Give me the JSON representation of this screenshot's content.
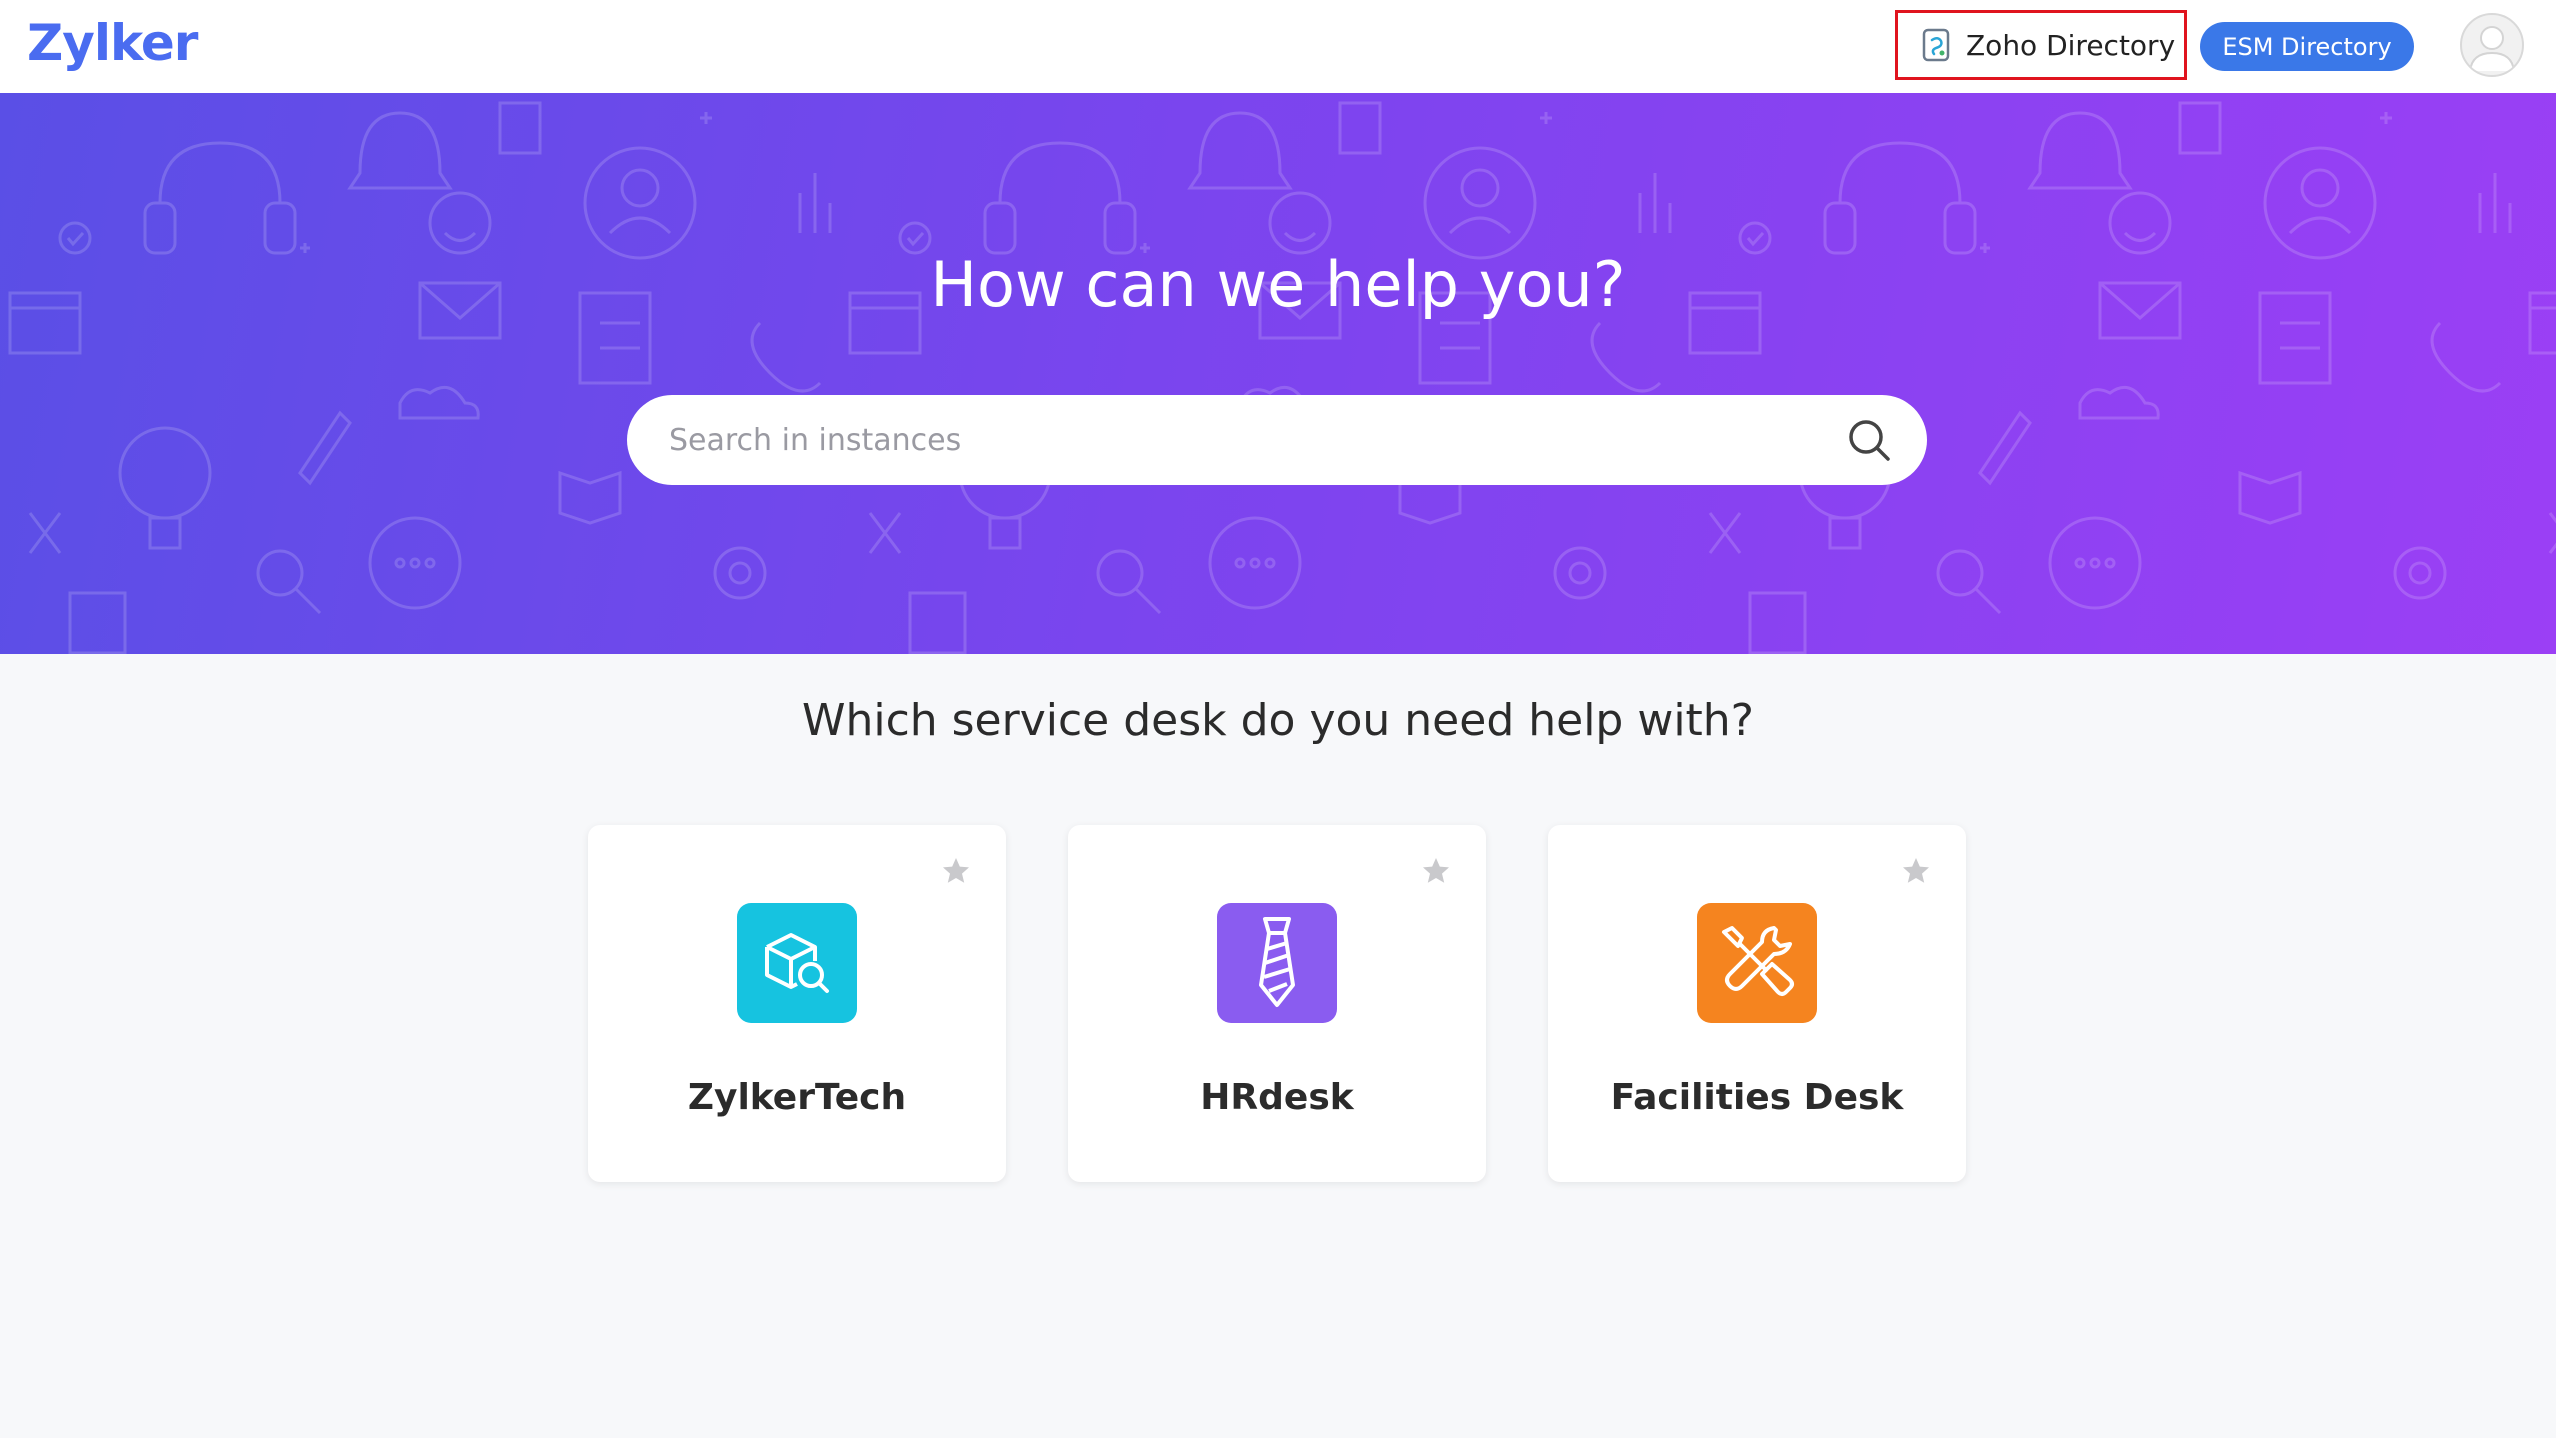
{
  "header": {
    "brand": "Zylker",
    "zoho_directory_label": "Zoho Directory",
    "esm_directory_label": "ESM Directory"
  },
  "hero": {
    "title": "How can we help you?",
    "search_placeholder": "Search in instances"
  },
  "main": {
    "section_title": "Which service desk do you need help with?",
    "desks": [
      {
        "label": "ZylkerTech",
        "icon": "cube-search-icon",
        "color": "#16c3e0"
      },
      {
        "label": "HRdesk",
        "icon": "necktie-icon",
        "color": "#8a5cf0"
      },
      {
        "label": "Facilities Desk",
        "icon": "tools-icon",
        "color": "#f5841f"
      }
    ]
  },
  "colors": {
    "brand": "#4a6cf0",
    "esm_button": "#3a78e8",
    "highlight_border": "#e0141e"
  }
}
